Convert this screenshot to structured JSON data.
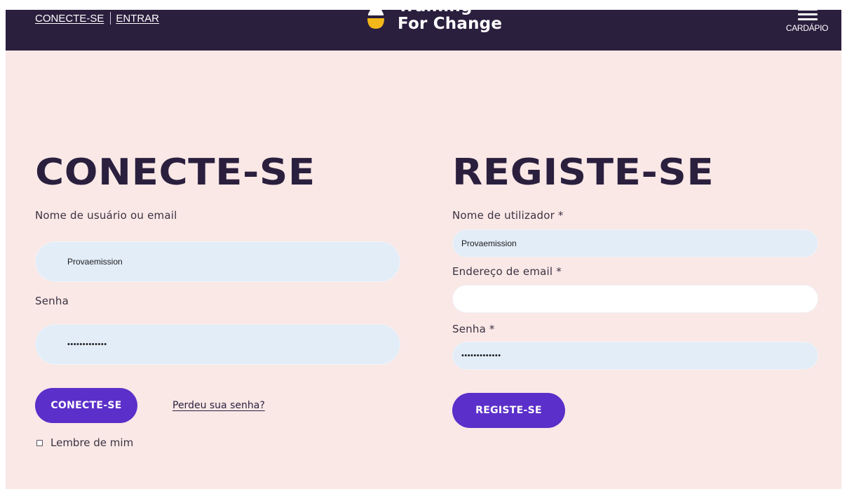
{
  "topbar": {
    "link_login": "CONECTE-SE",
    "link_enter": "ENTRAR",
    "logo_line1": "Training",
    "logo_line2": "For Change",
    "menu_label": "CARDÁPIO"
  },
  "login": {
    "heading": "CONECTE-SE",
    "username_label": "Nome de usuário ou email",
    "username_value": "Provaemission",
    "password_label": "Senha",
    "password_value": "•••••••••••••",
    "submit_label": "CONECTE-SE",
    "lost_password": "Perdeu sua senha?",
    "remember_label": "Lembre de mim"
  },
  "register": {
    "heading": "REGISTE-SE",
    "username_label": "Nome de utilizador *",
    "username_value": "Provaemission",
    "email_label": "Endereço de email *",
    "email_value": "",
    "password_label": "Senha *",
    "password_value": "•••••••••••••",
    "submit_label": "REGISTE-SE"
  },
  "colors": {
    "header_bg": "#2b1f3e",
    "page_bg": "#f9e8e6",
    "input_bg": "#e3edf8",
    "button_bg": "#5b2fc9",
    "logo_yellow": "#f4b81a"
  }
}
